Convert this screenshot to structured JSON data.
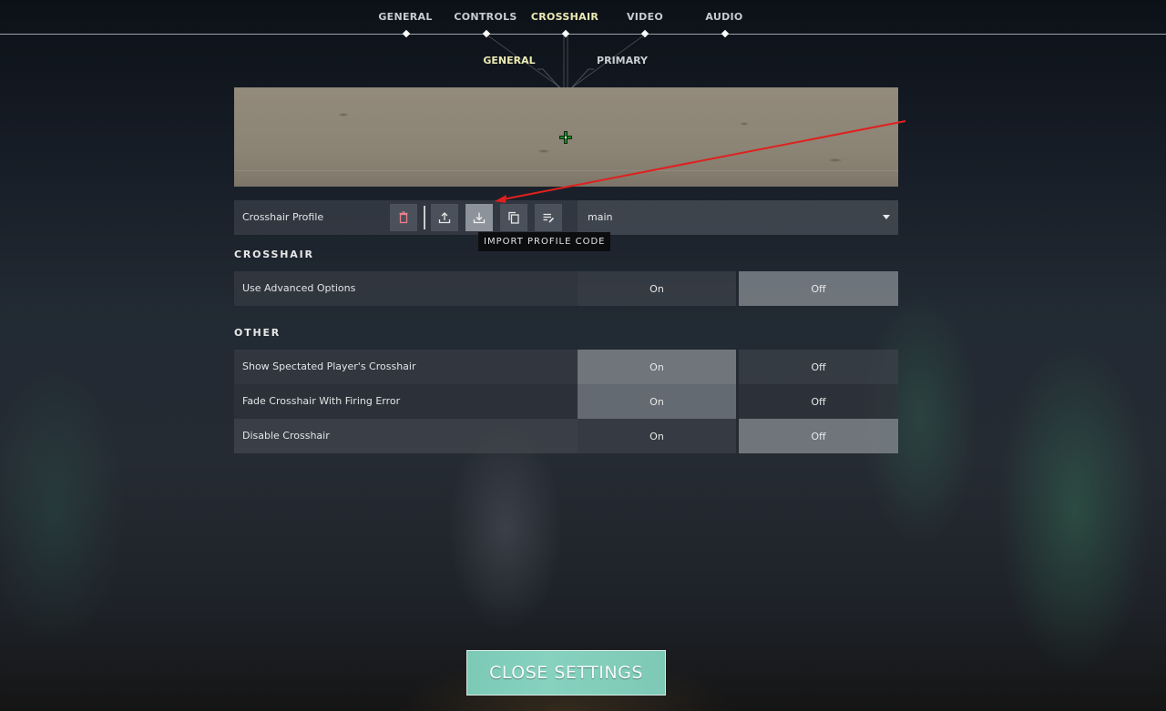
{
  "nav": {
    "tabs": [
      {
        "label": "GENERAL",
        "active": false
      },
      {
        "label": "CONTROLS",
        "active": false
      },
      {
        "label": "CROSSHAIR",
        "active": true
      },
      {
        "label": "VIDEO",
        "active": false
      },
      {
        "label": "AUDIO",
        "active": false
      }
    ],
    "subtabs": [
      {
        "label": "GENERAL",
        "active": true
      },
      {
        "label": "PRIMARY",
        "active": false
      }
    ]
  },
  "preview": {
    "crosshair_color": "#1f8a2a"
  },
  "profile": {
    "label": "Crosshair Profile",
    "buttons": [
      {
        "name": "delete",
        "icon": "trash-icon"
      },
      {
        "name": "export",
        "icon": "upload-icon"
      },
      {
        "name": "import",
        "icon": "download-icon",
        "active": true
      },
      {
        "name": "copy",
        "icon": "copy-icon"
      },
      {
        "name": "rename",
        "icon": "edit-list-icon"
      }
    ],
    "selected": "main",
    "tooltip": "IMPORT PROFILE CODE"
  },
  "sections": {
    "crosshair": {
      "title": "CROSSHAIR",
      "settings": [
        {
          "label": "Use Advanced Options",
          "on_label": "On",
          "off_label": "Off",
          "value": "Off"
        }
      ]
    },
    "other": {
      "title": "OTHER",
      "settings": [
        {
          "label": "Show Spectated Player's Crosshair",
          "on_label": "On",
          "off_label": "Off",
          "value": "On"
        },
        {
          "label": "Fade Crosshair With Firing Error",
          "on_label": "On",
          "off_label": "Off",
          "value": "On"
        },
        {
          "label": "Disable Crosshair",
          "on_label": "On",
          "off_label": "Off",
          "value": "Off"
        }
      ]
    }
  },
  "close_button": "CLOSE SETTINGS",
  "colors": {
    "accent_teal": "#82cfbc",
    "active_tab": "#ece9b4",
    "annotation_arrow": "#e0201e",
    "delete_icon": "#e8808a"
  }
}
